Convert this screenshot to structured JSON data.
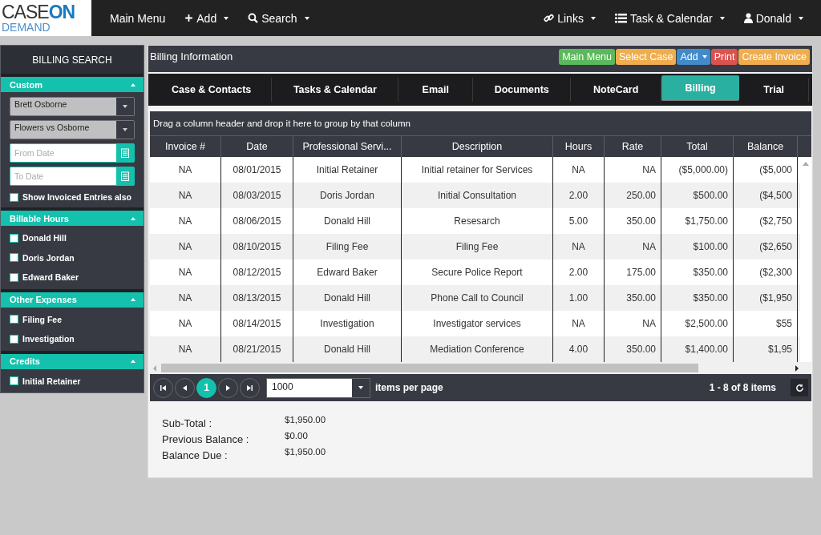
{
  "logo": {
    "line1": "CASE",
    "line2": "ON",
    "line3": "DEMAND"
  },
  "nav_left": [
    {
      "label": "Main Menu",
      "caret": false
    },
    {
      "label": "Add",
      "caret": true
    },
    {
      "label": "Search",
      "caret": true
    }
  ],
  "nav_right": [
    {
      "label": "Links",
      "caret": true
    },
    {
      "label": "Task & Calendar",
      "caret": true
    },
    {
      "label": "Donald",
      "caret": true
    }
  ],
  "sidebar": {
    "title": "BILLING SEARCH",
    "custom": {
      "title": "Custom",
      "selects": [
        "Brett Osborne",
        "Flowers vs Osborne"
      ],
      "dates": [
        {
          "placeholder": "From Date"
        },
        {
          "placeholder": "To Date"
        }
      ],
      "checkbox": {
        "label": "Show Invoiced Entries also",
        "checked": false
      }
    },
    "sections": [
      {
        "title": "Billable Hours",
        "items": [
          {
            "label": "Donald Hill",
            "checked": false
          },
          {
            "label": "Doris Jordan",
            "checked": false
          },
          {
            "label": "Edward Baker",
            "checked": false
          }
        ]
      },
      {
        "title": "Other Expenses",
        "items": [
          {
            "label": "Filing Fee",
            "checked": false
          },
          {
            "label": "Investigation",
            "checked": false
          }
        ]
      },
      {
        "title": "Credits",
        "items": [
          {
            "label": "Initial Retainer",
            "checked": false
          }
        ]
      }
    ]
  },
  "panel": {
    "title": "Billing Information",
    "buttons": [
      {
        "label": "Main Menu",
        "color": "#5cb85c",
        "caret": false
      },
      {
        "label": "Select Case",
        "color": "#f0ad4e",
        "caret": false
      },
      {
        "label": "Add",
        "color": "#428bca",
        "caret": true
      },
      {
        "label": "Print",
        "color": "#d9534f",
        "caret": false
      },
      {
        "label": "Create Invoice",
        "color": "#f0ad4e",
        "caret": false
      }
    ]
  },
  "tabs": [
    {
      "label": "Case & Contacts",
      "selected": false
    },
    {
      "label": "Tasks & Calendar",
      "selected": false
    },
    {
      "label": "Email",
      "selected": false
    },
    {
      "label": "Documents",
      "selected": false
    },
    {
      "label": "NoteCard",
      "selected": false
    },
    {
      "label": "Billing",
      "selected": true
    },
    {
      "label": "Trial",
      "selected": false
    }
  ],
  "grid": {
    "group_hint": "Drag a column header and drop it here to group by that column",
    "columns": [
      "Invoice #",
      "Date",
      "Professional Servi...",
      "Description",
      "Hours",
      "Rate",
      "Total",
      "Balance"
    ],
    "rows": [
      [
        "NA",
        "08/01/2015",
        "Initial Retainer",
        "Initial retainer for Services",
        "NA",
        "NA",
        "($5,000.00)",
        "($5,000"
      ],
      [
        "NA",
        "08/03/2015",
        "Doris Jordan",
        "Initial Consultation",
        "2.00",
        "250.00",
        "$500.00",
        "($4,500"
      ],
      [
        "NA",
        "08/06/2015",
        "Donald Hill",
        "Resesarch",
        "5.00",
        "350.00",
        "$1,750.00",
        "($2,750"
      ],
      [
        "NA",
        "08/10/2015",
        "Filing Fee",
        "Filing Fee",
        "NA",
        "NA",
        "$100.00",
        "($2,650"
      ],
      [
        "NA",
        "08/12/2015",
        "Edward Baker",
        "Secure Police Report",
        "2.00",
        "175.00",
        "$350.00",
        "($2,300"
      ],
      [
        "NA",
        "08/13/2015",
        "Donald Hill",
        "Phone Call to Council",
        "1.00",
        "350.00",
        "$350.00",
        "($1,950"
      ],
      [
        "NA",
        "08/14/2015",
        "Investigation",
        "Investigator services",
        "NA",
        "NA",
        "$2,500.00",
        "$55"
      ],
      [
        "NA",
        "08/21/2015",
        "Donald Hill",
        "Mediation Conference",
        "4.00",
        "350.00",
        "$1,400.00",
        "$1,95"
      ]
    ]
  },
  "pager": {
    "page": "1",
    "page_size": "1000",
    "per_page_label": "items per page",
    "summary": "1 - 8 of 8 items"
  },
  "totals": [
    {
      "label": "Sub-Total :",
      "value": "$1,950.00"
    },
    {
      "label": "Previous Balance :",
      "value": "$0.00"
    },
    {
      "label": "Balance Due :",
      "value": "$1,950.00"
    }
  ]
}
